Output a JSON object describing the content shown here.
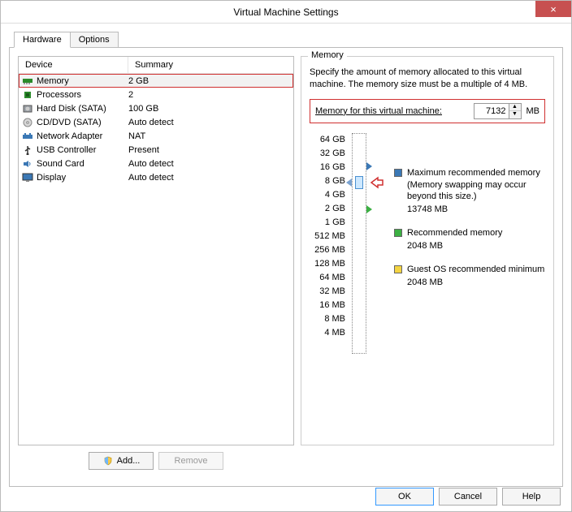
{
  "window": {
    "title": "Virtual Machine Settings",
    "close_icon": "×"
  },
  "tabs": {
    "hardware": "Hardware",
    "options": "Options"
  },
  "device_list": {
    "headers": {
      "device": "Device",
      "summary": "Summary"
    },
    "rows": [
      {
        "name": "Memory",
        "summary": "2 GB",
        "icon": "memory"
      },
      {
        "name": "Processors",
        "summary": "2",
        "icon": "cpu"
      },
      {
        "name": "Hard Disk (SATA)",
        "summary": "100 GB",
        "icon": "hdd"
      },
      {
        "name": "CD/DVD (SATA)",
        "summary": "Auto detect",
        "icon": "cd"
      },
      {
        "name": "Network Adapter",
        "summary": "NAT",
        "icon": "net"
      },
      {
        "name": "USB Controller",
        "summary": "Present",
        "icon": "usb"
      },
      {
        "name": "Sound Card",
        "summary": "Auto detect",
        "icon": "sound"
      },
      {
        "name": "Display",
        "summary": "Auto detect",
        "icon": "display"
      }
    ],
    "add_label": "Add...",
    "remove_label": "Remove"
  },
  "memory": {
    "group_title": "Memory",
    "description": "Specify the amount of memory allocated to this virtual machine. The memory size must be a multiple of 4 MB.",
    "input_label": "Memory for this virtual machine:",
    "value": "7132",
    "unit": "MB",
    "ticks": [
      "64 GB",
      "32 GB",
      "16 GB",
      "8 GB",
      "4 GB",
      "2 GB",
      "1 GB",
      "512 MB",
      "256 MB",
      "128 MB",
      "64 MB",
      "32 MB",
      "16 MB",
      "8 MB",
      "4 MB"
    ],
    "markers": {
      "max": {
        "color": "#3b78b5"
      },
      "rec": {
        "color": "#3cb043"
      },
      "guest": {
        "color": "#f4d442"
      }
    },
    "legends": {
      "max": {
        "title": "Maximum recommended memory",
        "note": "(Memory swapping may occur beyond this size.)",
        "value": "13748 MB",
        "swatch": "#3b78b5"
      },
      "rec": {
        "title": "Recommended memory",
        "value": "2048 MB",
        "swatch": "#3cb043"
      },
      "guest": {
        "title": "Guest OS recommended minimum",
        "value": "2048 MB",
        "swatch": "#f4d442"
      }
    }
  },
  "footer": {
    "ok": "OK",
    "cancel": "Cancel",
    "help": "Help"
  }
}
